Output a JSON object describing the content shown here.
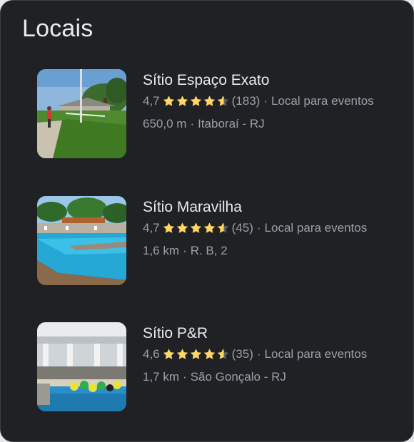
{
  "section": {
    "title": "Locais"
  },
  "colors": {
    "star": "#fdd663",
    "star_empty": "#5f6368"
  },
  "places": [
    {
      "name": "Sítio Espaço Exato",
      "rating": "4,7",
      "rating_value": 4.7,
      "reviews": "(183)",
      "category": "Local para eventos",
      "distance": "650,0 m",
      "location": "Itaboraí - RJ"
    },
    {
      "name": "Sítio Maravilha",
      "rating": "4,7",
      "rating_value": 4.7,
      "reviews": "(45)",
      "category": "Local para eventos",
      "distance": "1,6 km",
      "location": "R. B, 2"
    },
    {
      "name": "Sítio P&R",
      "rating": "4,6",
      "rating_value": 4.6,
      "reviews": "(35)",
      "category": "Local para eventos",
      "distance": "1,7 km",
      "location": "São Gonçalo - RJ"
    }
  ]
}
